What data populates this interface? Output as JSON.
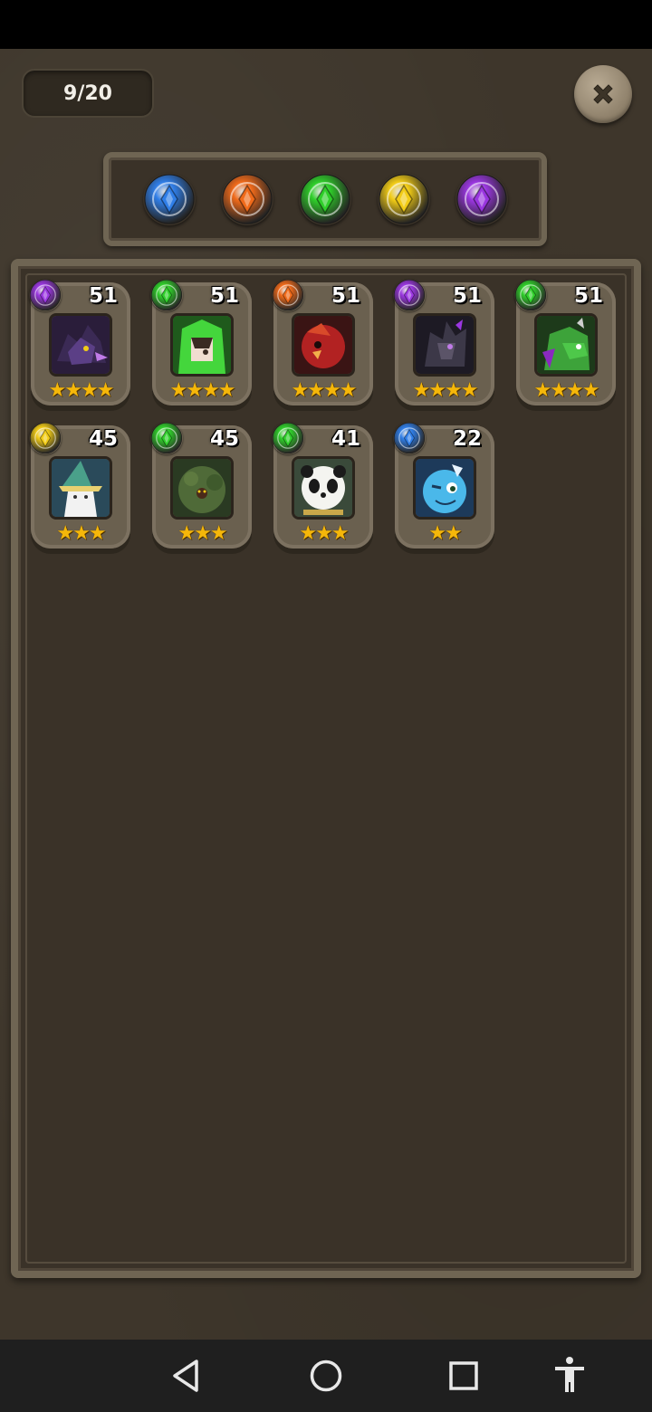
{
  "header": {
    "counter_text": "9/20",
    "close_icon": "close-icon"
  },
  "filters": [
    {
      "name": "water",
      "color": "#2f7ee8",
      "icon": "blue-element-orb-icon"
    },
    {
      "name": "fire",
      "color": "#f06a1a",
      "icon": "orange-element-orb-icon"
    },
    {
      "name": "nature",
      "color": "#2fcf2a",
      "icon": "green-element-orb-icon"
    },
    {
      "name": "light",
      "color": "#f2cc16",
      "icon": "yellow-element-orb-icon"
    },
    {
      "name": "dark",
      "color": "#9a36e0",
      "icon": "purple-element-orb-icon"
    }
  ],
  "monsters": [
    {
      "level": "51",
      "element": "dark",
      "stars": 4,
      "portrait": "purple-dragon-portrait",
      "stars_text": "★★★★"
    },
    {
      "level": "51",
      "element": "nature",
      "stars": 4,
      "portrait": "green-hooded-girl-portrait",
      "stars_text": "★★★★"
    },
    {
      "level": "51",
      "element": "fire",
      "stars": 4,
      "portrait": "red-bird-portrait",
      "stars_text": "★★★★"
    },
    {
      "level": "51",
      "element": "dark",
      "stars": 4,
      "portrait": "dark-dragon-portrait",
      "stars_text": "★★★★"
    },
    {
      "level": "51",
      "element": "nature",
      "stars": 4,
      "portrait": "green-dragon-portrait",
      "stars_text": "★★★★"
    },
    {
      "level": "45",
      "element": "light",
      "stars": 3,
      "portrait": "white-wizard-portrait",
      "stars_text": "★★★"
    },
    {
      "level": "45",
      "element": "nature",
      "stars": 3,
      "portrait": "tree-beast-portrait",
      "stars_text": "★★★"
    },
    {
      "level": "41",
      "element": "nature",
      "stars": 3,
      "portrait": "panda-portrait",
      "stars_text": "★★★"
    },
    {
      "level": "22",
      "element": "water",
      "stars": 2,
      "portrait": "blue-dino-portrait",
      "stars_text": "★★"
    }
  ],
  "colors": {
    "water": "#2f7ee8",
    "fire": "#f06a1a",
    "nature": "#2fcf2a",
    "light": "#f2cc16",
    "dark": "#9a36e0",
    "panel": "#3a3228",
    "frame": "#6f6553",
    "star": "#f5b70a"
  },
  "navigation": [
    {
      "name": "back",
      "icon": "back-triangle-icon"
    },
    {
      "name": "home",
      "icon": "home-circle-icon"
    },
    {
      "name": "recents",
      "icon": "recents-square-icon"
    },
    {
      "name": "accessibility",
      "icon": "accessibility-person-icon"
    }
  ]
}
